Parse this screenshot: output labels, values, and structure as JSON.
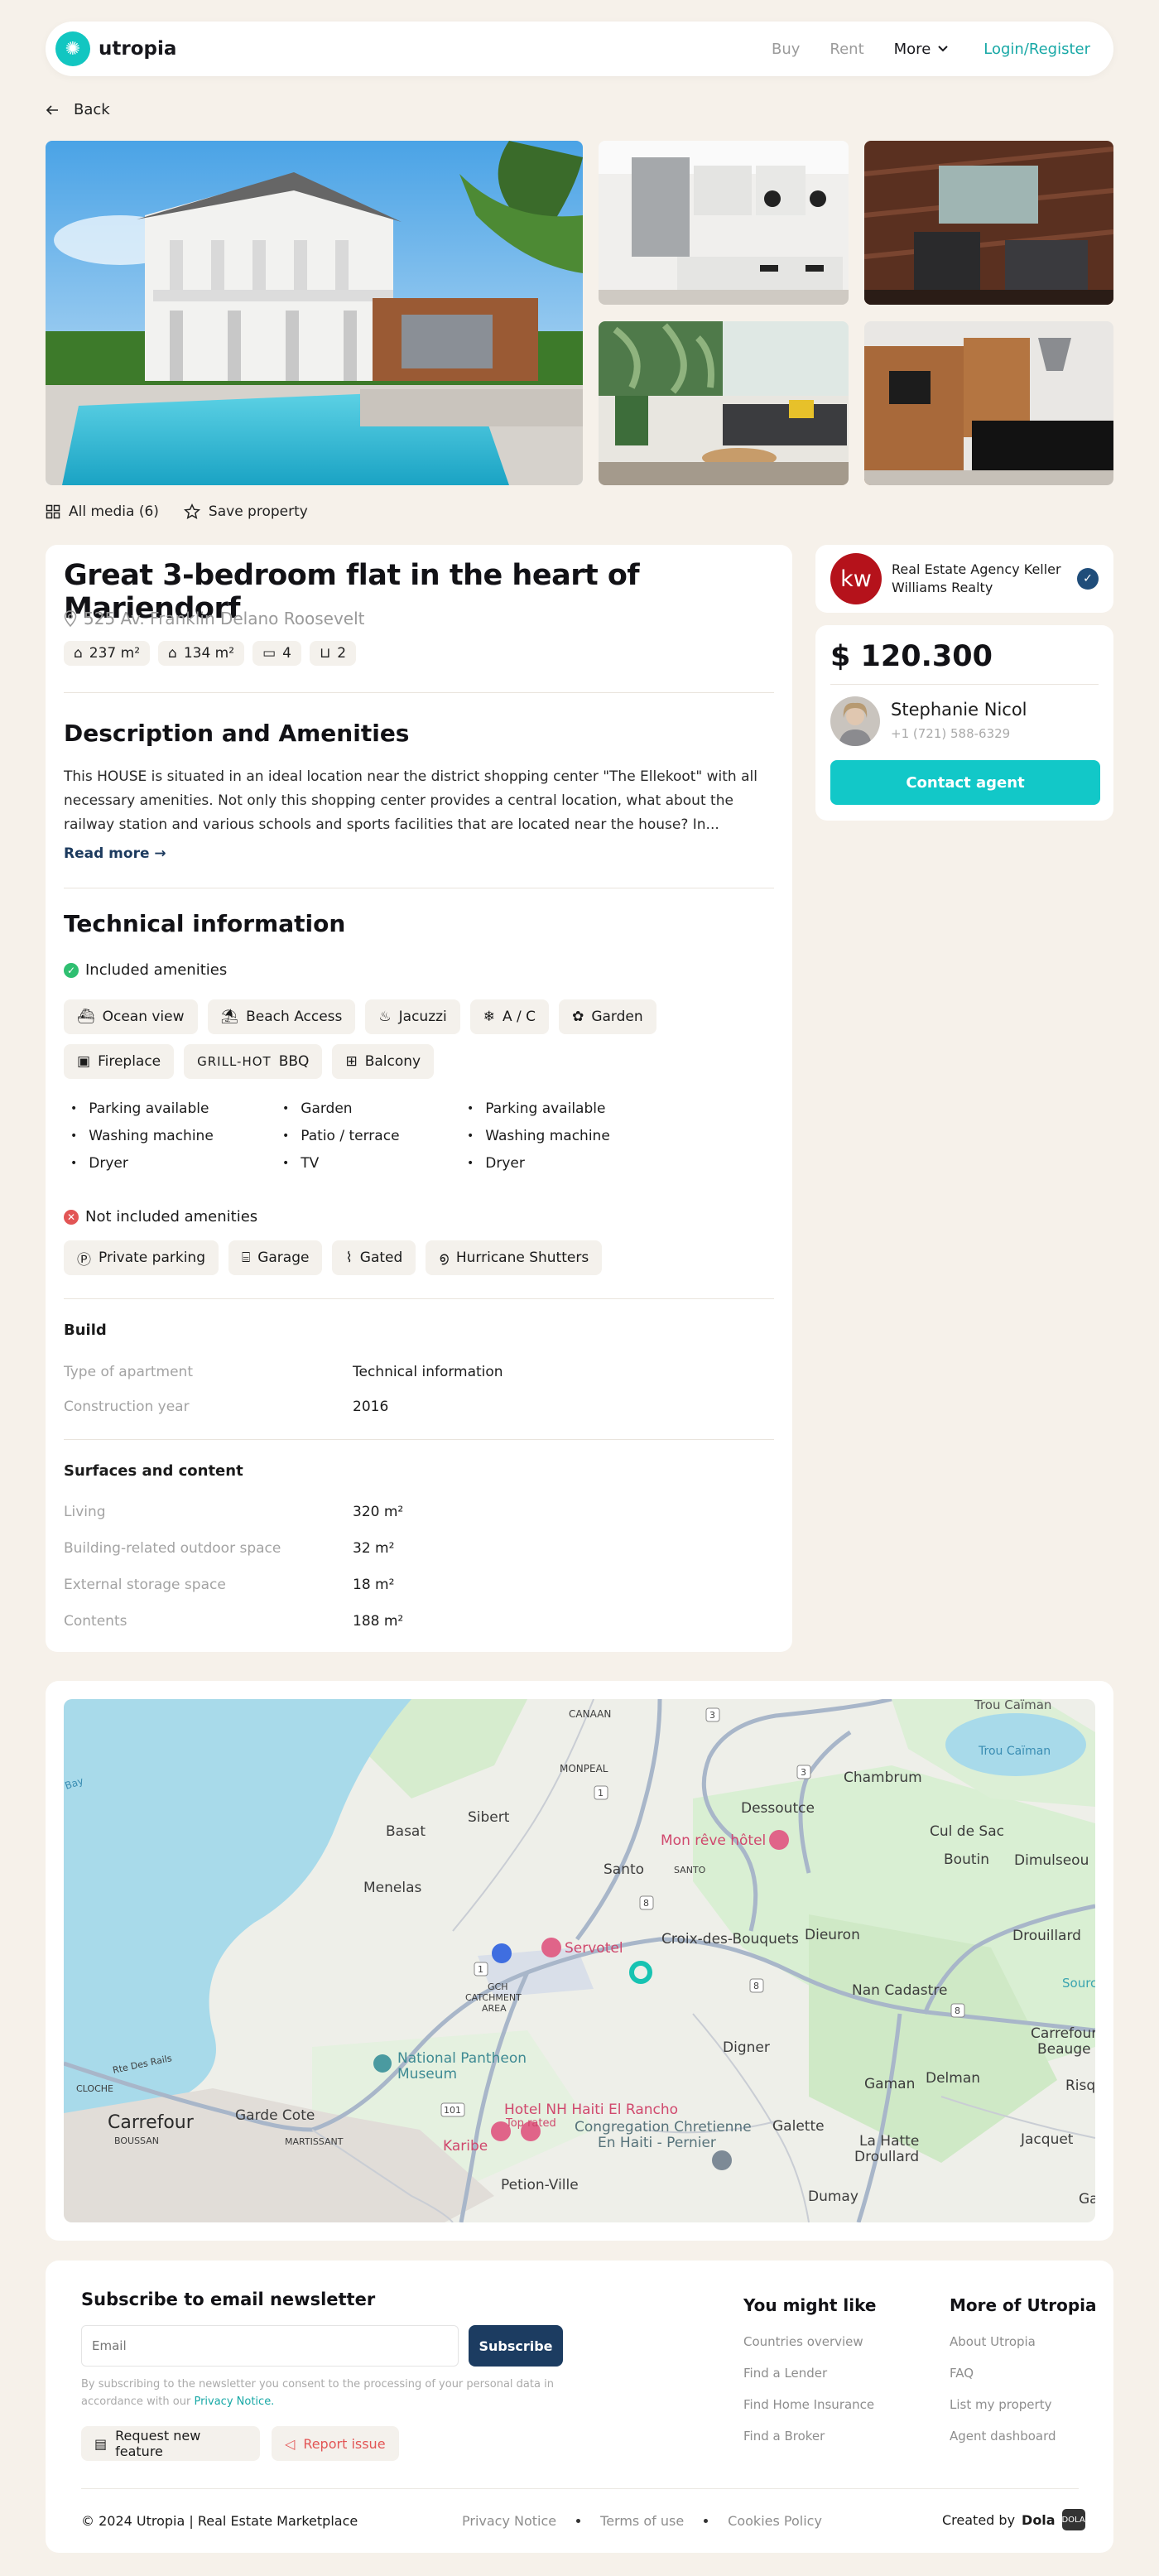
{
  "header": {
    "logo_text": "utropia",
    "nav": {
      "buy": "Buy",
      "rent": "Rent",
      "more": "More",
      "login": "Login/Register"
    }
  },
  "back_label": "Back",
  "media": {
    "all_media": "All media (6)",
    "save": "Save property"
  },
  "property": {
    "title": "Great 3-bedroom flat in the heart of Mariendorf",
    "address": "525 Av. Franklin Delano Roosevelt",
    "stats": [
      "237 m²",
      "134 m²",
      "4",
      "2"
    ]
  },
  "description": {
    "heading": "Description and Amenities",
    "text": "This HOUSE is situated in an ideal location near the district shopping center \"The Ellekoot\" with all necessary amenities. Not only this shopping center provides a central location, what about the railway station and various schools and sports facilities that are located near the house? In...",
    "read_more": "Read more"
  },
  "technical": {
    "heading": "Technical information",
    "included_label": "Included amenities",
    "included": [
      "Ocean view",
      "Beach Access",
      "Jacuzzi",
      "A / C",
      "Garden",
      "Fireplace",
      "BBQ",
      "Balcony"
    ],
    "grill_label": "GRILL-HOT",
    "bullets": [
      "Parking available",
      "Garden",
      "Parking available",
      "Washing machine",
      "Patio / terrace",
      "Washing machine",
      "Dryer",
      "TV",
      "Dryer"
    ],
    "not_included_label": "Not included amenities",
    "not_included": [
      "Private parking",
      "Garage",
      "Gated",
      "Hurricane Shutters"
    ]
  },
  "build": {
    "heading": "Build",
    "rows": [
      {
        "k": "Type of apartment",
        "v": "Technical information"
      },
      {
        "k": "Construction year",
        "v": "2016"
      }
    ]
  },
  "surfaces": {
    "heading": "Surfaces and content",
    "rows": [
      {
        "k": "Living",
        "v": "320 m²"
      },
      {
        "k": "Building-related outdoor space",
        "v": "32 m²"
      },
      {
        "k": "External storage space",
        "v": "18 m²"
      },
      {
        "k": "Contents",
        "v": "188 m²"
      }
    ]
  },
  "agency": {
    "logo": "kw",
    "name": "Real Estate Agency Keller Williams Realty"
  },
  "listing": {
    "price": "$ 120.300",
    "agent_name": "Stephanie Nicol",
    "agent_phone": "+1 (721) 588-6329",
    "contact": "Contact agent"
  },
  "map": {
    "labels": [
      "Trou Caïman",
      "CANAAN",
      "MONPEAL",
      "Chambrum",
      "Dessoutce",
      "Basat",
      "Sibert",
      "Mon rêve hôtel",
      "Cul de Sac",
      "Boutin",
      "Dimulseou",
      "Menelas",
      "Santo",
      "SANTO",
      "Dieuron",
      "Drouillard",
      "Servotel",
      "Croix-des-Bouquets",
      "Nan Cadastre",
      "Carrefour Beauge",
      "GCH CATCHMENT AREA",
      "Digner",
      "National Pantheon Museum",
      "Gaman",
      "Delman",
      "Carrefour",
      "BOUSSAN",
      "Garde Cote",
      "MARTISSANT",
      "Hotel NH Haiti El Rancho",
      "Top rated",
      "Karibe",
      "Congregation Chretienne En Haiti - Pernier",
      "Galette",
      "La Hatte Droullard",
      "Jacquet",
      "Petion-Ville",
      "Dumay",
      "Risq",
      "Sourc",
      "CLOCHE",
      "Rte Des Rails",
      "Bay",
      "Ga"
    ],
    "road_numbers": [
      "3",
      "3",
      "1",
      "8",
      "8",
      "8",
      "1",
      "101"
    ]
  },
  "footer": {
    "newsletter_title": "Subscribe to email newsletter",
    "email_placeholder": "Email",
    "subscribe": "Subscribe",
    "note": "By subscribing to the newsletter you consent to the processing of your personal data in accordance with our ",
    "privacy_link": "Privacy Notice.",
    "request_feature": "Request new feature",
    "report_issue": "Report issue",
    "col1_title": "You might like",
    "col1": [
      "Countries overview",
      "Find a Lender",
      "Find Home Insurance",
      "Find a Broker"
    ],
    "col2_title": "More of Utropia",
    "col2": [
      "About Utropia",
      "FAQ",
      "List my property",
      "Agent dashboard"
    ],
    "copyright": "© 2024 Utropia | Real Estate Marketplace",
    "legal": [
      "Privacy Notice",
      "Terms of use",
      "Cookies Policy"
    ],
    "created_by": "Created by",
    "created_brand": "Dola",
    "brand_box": "DOLA"
  },
  "colors": {
    "accent": "#12c8c8",
    "navy": "#1c3c61",
    "success": "#2fbf71",
    "danger": "#e25555",
    "agency_red": "#b5121b"
  }
}
